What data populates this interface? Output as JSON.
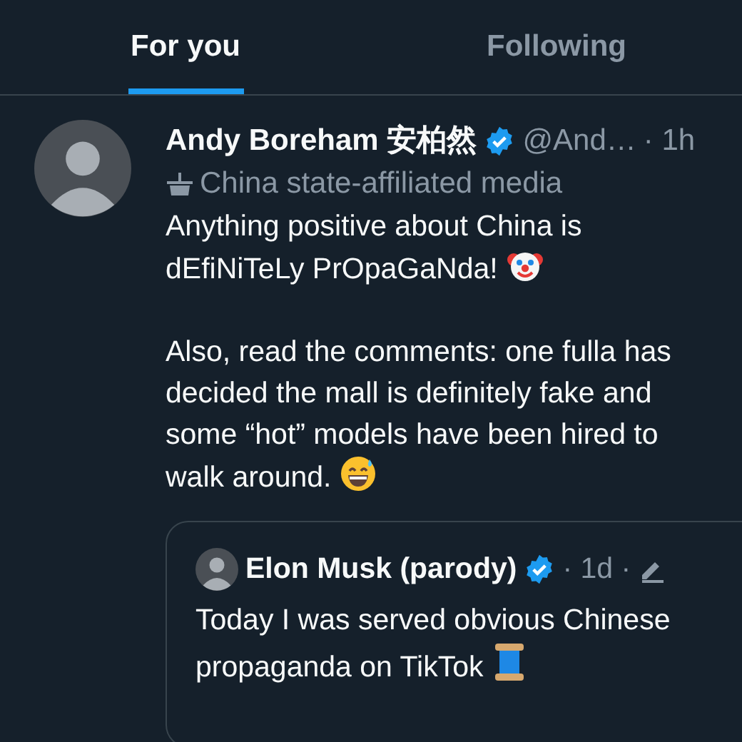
{
  "tabs": [
    {
      "label": "For you",
      "selected": true
    },
    {
      "label": "Following",
      "selected": false
    }
  ],
  "tweet": {
    "name": "Andy Boreham 安柏然",
    "verified": true,
    "handle": "@And…",
    "time": "· 1h",
    "label": "China state-affiliated media",
    "paragraphs": [
      {
        "kind": "clown",
        "lines": [
          "Anything positive about China is",
          "dEfiNiTeLy PrOpaGaNda!"
        ]
      },
      {
        "kind": "sweat",
        "lines": [
          "Also, read the comments: one fulla has",
          "decided the mall is definitely fake and",
          "some “hot” models have been hired to",
          "walk around."
        ]
      }
    ],
    "quote": {
      "name": "Elon Musk (parody)",
      "verified": true,
      "time": "· 1d ·",
      "edited": true,
      "kind": "spool",
      "lines": [
        "Today I was served obvious Chinese",
        "propaganda on TikTok"
      ]
    }
  }
}
